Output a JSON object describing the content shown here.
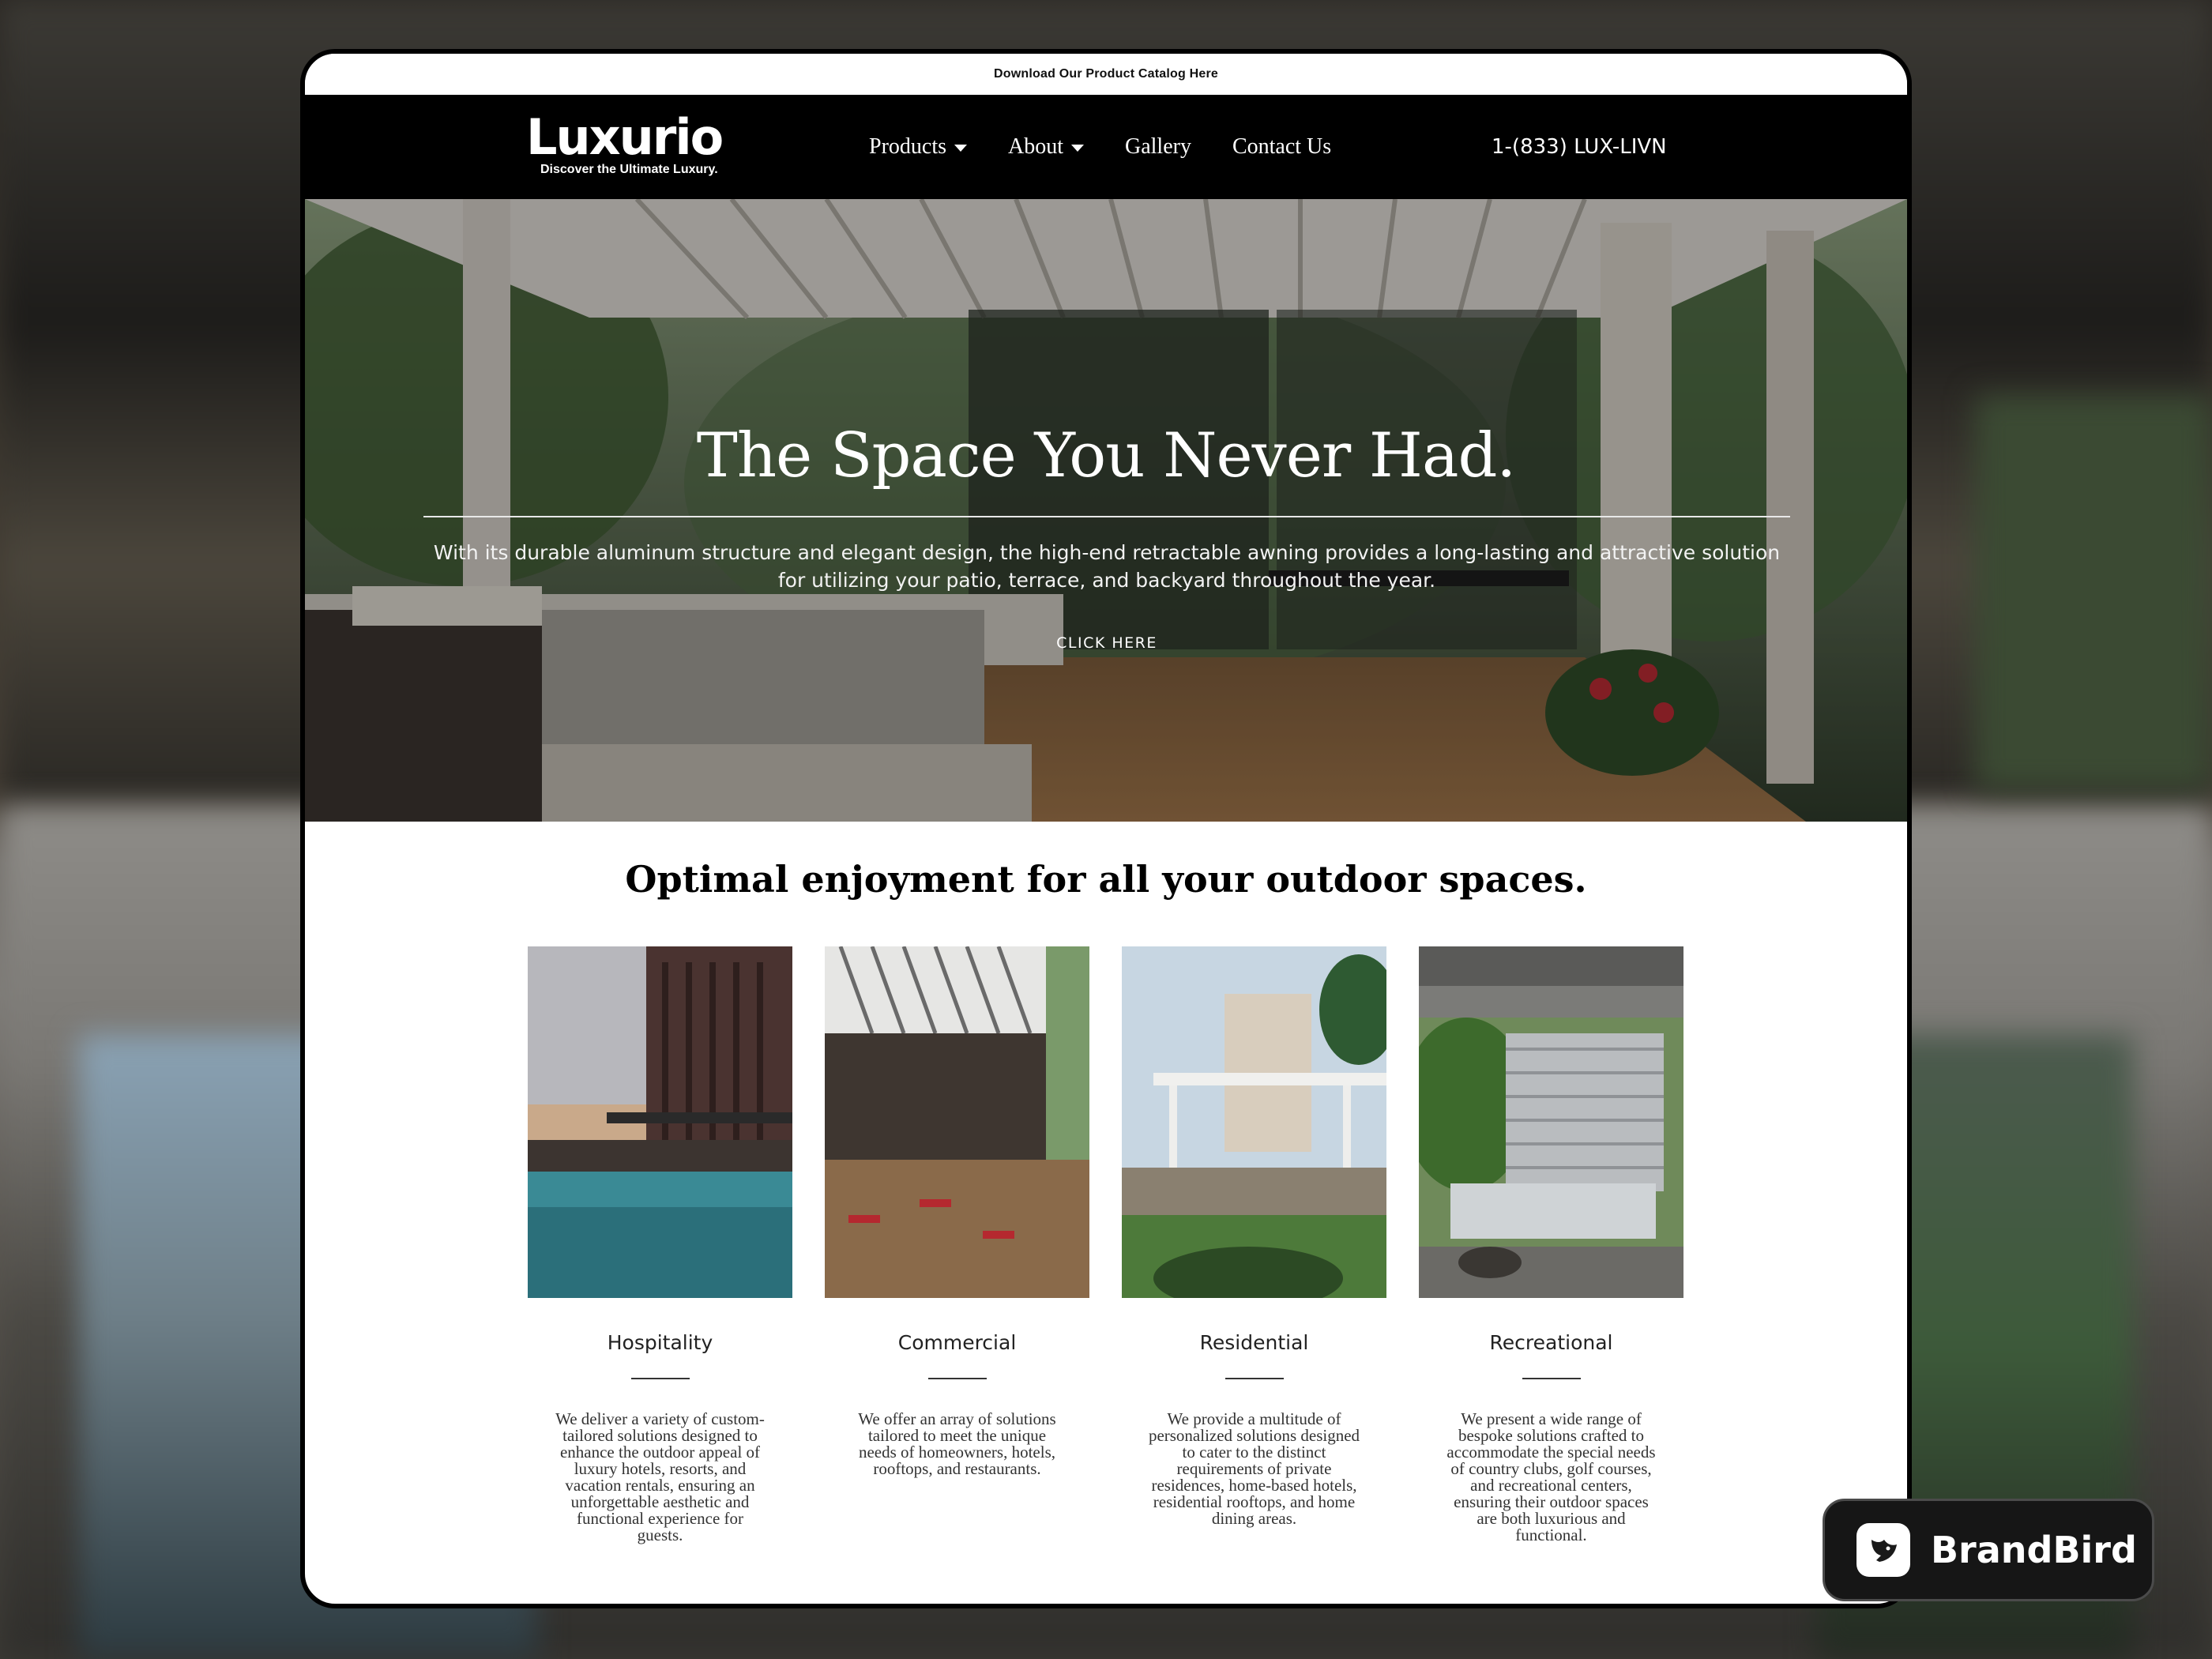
{
  "topbar": {
    "text": "Download Our Product Catalog Here"
  },
  "brand": {
    "name": "Luxurio",
    "tagline": "Discover the Ultimate Luxury."
  },
  "nav": {
    "items": [
      {
        "label": "Products",
        "has_dropdown": true
      },
      {
        "label": "About",
        "has_dropdown": true
      },
      {
        "label": "Gallery",
        "has_dropdown": false
      },
      {
        "label": "Contact Us",
        "has_dropdown": false
      }
    ],
    "phone": "1-(833) LUX-LIVN"
  },
  "hero": {
    "title": "The Space You Never Had.",
    "subtitle": "With its durable aluminum structure and elegant design, the high-end retractable awning provides a long-lasting and attractive solution for utilizing your patio, terrace, and backyard throughout the year.",
    "button": "CLICK HERE"
  },
  "section": {
    "title": "Optimal enjoyment for all your outdoor spaces."
  },
  "cards": [
    {
      "title": "Hospitality",
      "text": "We deliver a variety of custom-tailored solutions designed to enhance the outdoor appeal of luxury hotels, resorts, and vacation rentals, ensuring an unforgettable aesthetic and functional experience for guests."
    },
    {
      "title": "Commercial",
      "text": "We offer an array of solutions tailored to meet the unique needs of homeowners, hotels, rooftops, and restaurants."
    },
    {
      "title": "Residential",
      "text": "We provide a multitude of personalized solutions designed to cater to the distinct requirements of private residences, home-based hotels, residential rooftops, and home dining areas."
    },
    {
      "title": "Recreational",
      "text": "We present a wide range of bespoke solutions crafted to accommodate the special needs of country clubs, golf courses, and recreational centers, ensuring their outdoor spaces are both luxurious and functional."
    }
  ],
  "watermark": {
    "text": "BrandBird"
  }
}
